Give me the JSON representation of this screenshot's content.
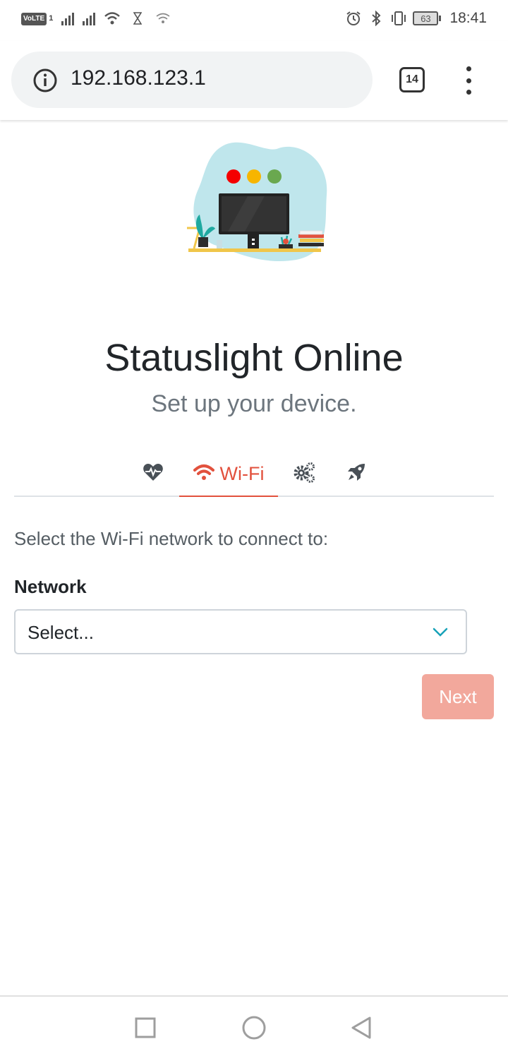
{
  "status_bar": {
    "volte_label": "VoLTE",
    "sim_label": "1",
    "battery_level": "63",
    "time": "18:41",
    "icons": [
      "signal-icon",
      "signal-icon",
      "wifi-icon",
      "hourglass-icon",
      "wifi-icon",
      "alarm-icon",
      "bluetooth-icon",
      "vibrate-icon",
      "battery-icon"
    ]
  },
  "browser": {
    "url": "192.168.123.1",
    "tab_count": "14",
    "icons": {
      "info": "info-icon",
      "menu": "more-vert-icon"
    }
  },
  "page": {
    "title": "Statuslight Online",
    "subtitle": "Set up your device.",
    "illustration": "monitor-with-status-lights",
    "steps": [
      {
        "icon": "heartbeat-icon",
        "label": "",
        "active": false
      },
      {
        "icon": "wifi-icon",
        "label": "Wi-Fi",
        "active": true
      },
      {
        "icon": "cogs-icon",
        "label": "",
        "active": false
      },
      {
        "icon": "rocket-icon",
        "label": "",
        "active": false
      }
    ],
    "intro": "Select the Wi-Fi network to connect to:",
    "network_label": "Network",
    "network_select": {
      "value": "Select..."
    },
    "next_label": "Next"
  },
  "colors": {
    "accent": "#e2513d",
    "button_disabled": "#f2a89c",
    "chevron": "#17a2b8",
    "icon_dark": "#495057"
  },
  "nav_bar": {
    "icons": [
      "recents-square-icon",
      "home-circle-icon",
      "back-triangle-icon"
    ]
  }
}
